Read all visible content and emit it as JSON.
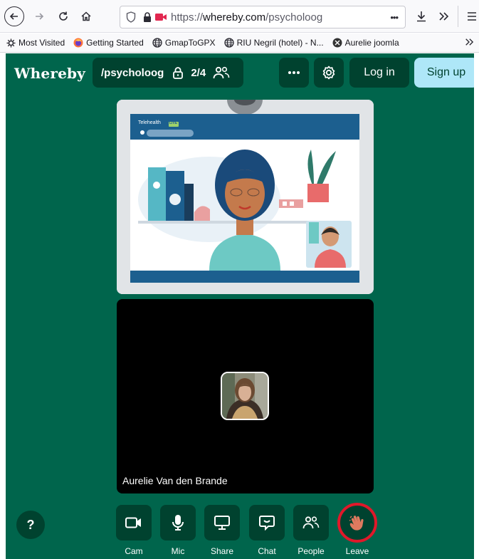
{
  "browser": {
    "url": "https://whereby.com/psycholoog",
    "url_domain": "whereby.com",
    "url_path": "/psycholoog",
    "url_prefix": "https://",
    "page_actions": "•••",
    "bookmarks": [
      {
        "label": "Most Visited",
        "icon": "gear-icon"
      },
      {
        "label": "Getting Started",
        "icon": "firefox-icon"
      },
      {
        "label": "GmapToGPX",
        "icon": "globe-icon"
      },
      {
        "label": "RIU Negril (hotel) - N...",
        "icon": "globe-icon"
      },
      {
        "label": "Aurelie joomla",
        "icon": "joomla-icon"
      }
    ]
  },
  "header": {
    "logo": "Whereby",
    "room_name": "/psycholoog",
    "participants": "2/4",
    "login_label": "Log in",
    "signup_label": "Sign up"
  },
  "tile1": {
    "title": "Telehealth",
    "badge": "LIVE"
  },
  "tile2": {
    "participant_name": "Aurelie Van den Brande"
  },
  "help_label": "?",
  "controls": [
    {
      "label": "Cam",
      "icon": "camera-icon"
    },
    {
      "label": "Mic",
      "icon": "microphone-icon"
    },
    {
      "label": "Share",
      "icon": "screen-share-icon"
    },
    {
      "label": "Chat",
      "icon": "chat-icon"
    },
    {
      "label": "People",
      "icon": "people-icon"
    },
    {
      "label": "Leave",
      "icon": "waving-hand-icon"
    }
  ],
  "colors": {
    "app_bg": "#00654c",
    "button_bg": "#00422f",
    "signup_bg": "#aee7f8",
    "leave_ring": "#e0182a"
  }
}
